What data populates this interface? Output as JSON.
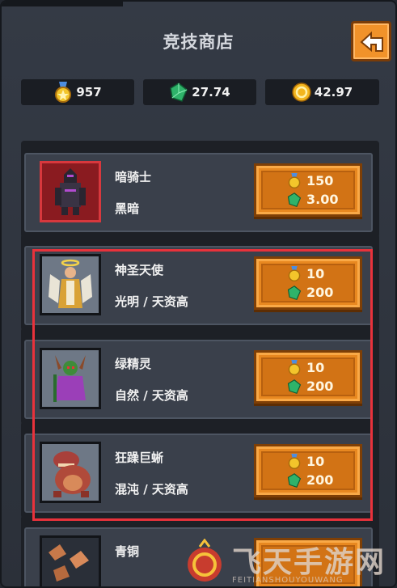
{
  "header": {
    "title": "竞技商店"
  },
  "currencies": [
    {
      "icon": "medal-icon",
      "value": "957"
    },
    {
      "icon": "green-gem-icon",
      "value": "27.74"
    },
    {
      "icon": "gold-coin-icon",
      "value": "42.97"
    }
  ],
  "items": [
    {
      "name": "暗骑士",
      "tags": "黑暗",
      "price_medal": "150",
      "price_gem": "3.00",
      "portrait": "dark-knight-portrait"
    },
    {
      "name": "神圣天使",
      "tags": "光明 / 天资高",
      "price_medal": "10",
      "price_gem": "200",
      "portrait": "holy-angel-portrait"
    },
    {
      "name": "绿精灵",
      "tags": "自然 / 天资高",
      "price_medal": "10",
      "price_gem": "200",
      "portrait": "green-elf-portrait"
    },
    {
      "name": "狂躁巨蜥",
      "tags": "混沌 / 天资高",
      "price_medal": "10",
      "price_gem": "200",
      "portrait": "raging-lizard-portrait"
    },
    {
      "name": "青铜",
      "tags": "",
      "price_medal": "",
      "price_gem": "",
      "portrait": "bronze-ore-portrait"
    }
  ],
  "watermark": {
    "text": "飞天手游网",
    "sub": "FEITIANSHOUYOUWANG"
  },
  "colors": {
    "accent_orange": "#e88820",
    "highlight_red": "#e8323b",
    "panel": "#3a404b"
  }
}
